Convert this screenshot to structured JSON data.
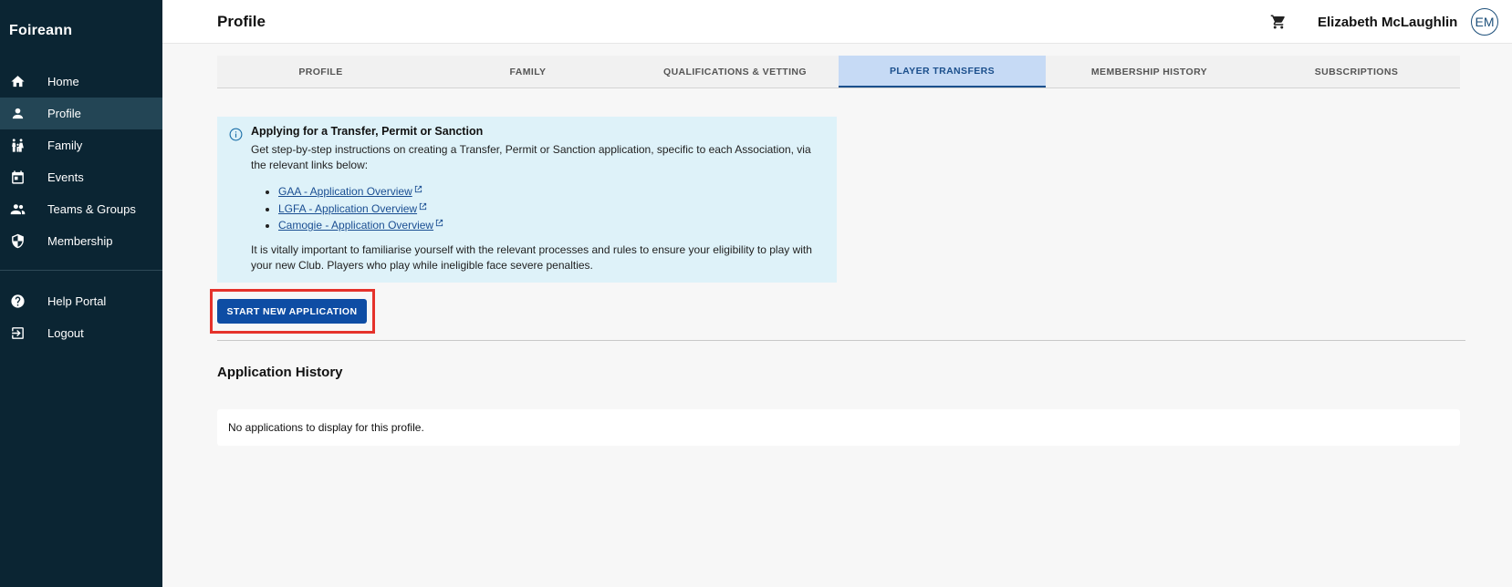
{
  "sidebar": {
    "brand": "Foireann",
    "items": [
      {
        "label": "Home",
        "icon": "home-icon"
      },
      {
        "label": "Profile",
        "icon": "person-icon",
        "active": true
      },
      {
        "label": "Family",
        "icon": "family-icon"
      },
      {
        "label": "Events",
        "icon": "calendar-icon"
      },
      {
        "label": "Teams & Groups",
        "icon": "group-icon"
      },
      {
        "label": "Membership",
        "icon": "shield-icon"
      }
    ],
    "bottom_items": [
      {
        "label": "Help Portal",
        "icon": "help-icon"
      },
      {
        "label": "Logout",
        "icon": "logout-icon"
      }
    ]
  },
  "header": {
    "title": "Profile",
    "user_name": "Elizabeth McLaughlin",
    "avatar_initials": "EM",
    "cart_icon": "cart-icon"
  },
  "tabs": [
    {
      "label": "PROFILE"
    },
    {
      "label": "FAMILY"
    },
    {
      "label": "QUALIFICATIONS & VETTING"
    },
    {
      "label": "PLAYER TRANSFERS",
      "active": true
    },
    {
      "label": "MEMBERSHIP HISTORY"
    },
    {
      "label": "SUBSCRIPTIONS"
    }
  ],
  "info": {
    "title": "Applying for a Transfer, Permit or Sanction",
    "intro": "Get step-by-step instructions on creating a Transfer, Permit or Sanction application, specific to each Association, via the relevant links below:",
    "links": [
      {
        "label": "GAA - Application Overview"
      },
      {
        "label": "LGFA - Application Overview"
      },
      {
        "label": "Camogie - Application Overview"
      }
    ],
    "warning": "It is vitally important to familiarise yourself with the relevant processes and rules to ensure your eligibility to play with your new Club. Players who play while ineligible face severe penalties."
  },
  "actions": {
    "start_label": "START NEW APPLICATION"
  },
  "history": {
    "title": "Application History",
    "empty_text": "No applications to display for this profile."
  },
  "colors": {
    "sidebar_bg": "#0b2533",
    "primary": "#0e4da4",
    "info_bg": "#def2f9",
    "active_tab_bg": "#c6daf5",
    "highlight": "#e5322b"
  }
}
